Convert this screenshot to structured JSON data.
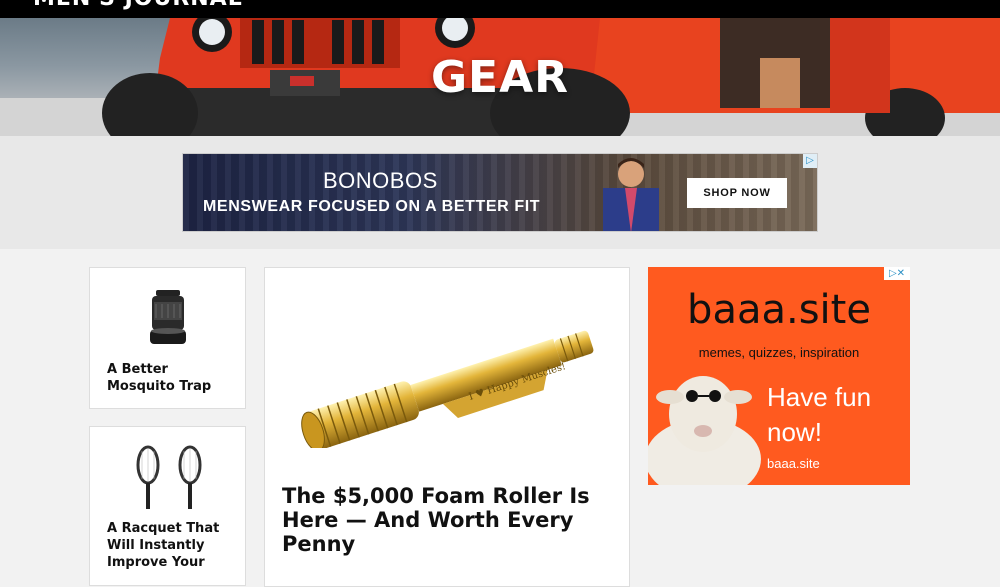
{
  "header": {
    "logo_text": "MEN'S JOURNAL"
  },
  "hero": {
    "title": "GEAR"
  },
  "banner_ad": {
    "brand": "BONOBOS",
    "tagline": "MENSWEAR FOCUSED ON A BETTER FIT",
    "cta": "SHOP NOW",
    "adchoices": "▷"
  },
  "cards": [
    {
      "title": "A Better Mosquito Trap",
      "icon": "mosquito-trap-image"
    },
    {
      "title": "A Racquet That Will Instantly Improve Your",
      "icon": "tennis-racquets-image"
    }
  ],
  "feature": {
    "title": "The $5,000 Foam Roller Is Here — And Worth Every Penny",
    "engraving": "I ♥ Happy Muscles!",
    "icon": "gold-foam-roller-image"
  },
  "side_ad": {
    "brand": "baaa.site",
    "subtitle": "memes, quizzes, inspiration",
    "headline": "Have fun now!",
    "url": "baaa.site",
    "adchoices": "▷✕"
  },
  "colors": {
    "topbar": "#000000",
    "side_ad_bg": "#ff5a1f",
    "banner_bg": "#1d2444"
  }
}
